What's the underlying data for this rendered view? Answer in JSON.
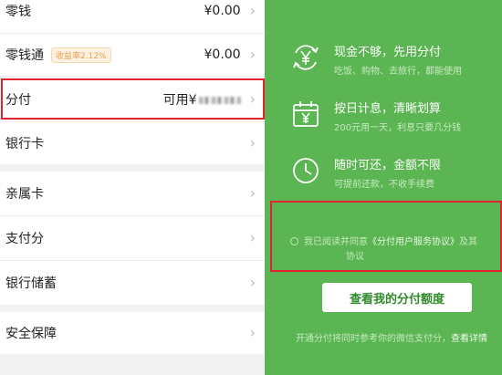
{
  "wallet": {
    "rows": [
      {
        "label": "零钱",
        "value": "¥0.00"
      },
      {
        "label": "零钱通",
        "badge": "收益率2.12%",
        "value": "¥0.00"
      },
      {
        "label": "分付",
        "value": "可用¥"
      },
      {
        "label": "银行卡"
      },
      {
        "label": "亲属卡"
      },
      {
        "label": "支付分"
      },
      {
        "label": "银行储蓄"
      },
      {
        "label": "安全保障"
      }
    ],
    "chevron": "›"
  },
  "promo": {
    "features": [
      {
        "icon": "yen-cycle-icon",
        "title": "现金不够，先用分付",
        "subtitle": "吃饭、购物、去旅行，都能使用"
      },
      {
        "icon": "calendar-yen-icon",
        "title": "按日计息，清晰划算",
        "subtitle": "200元用一天，利息只要几分钱"
      },
      {
        "icon": "clock-icon",
        "title": "随时可还，金额不限",
        "subtitle": "可提前还款，不收手续费"
      }
    ],
    "agreement": {
      "prefix": "我已阅读并同意",
      "link": "《分付用户服务协议》",
      "suffix": "及其",
      "line2": "协议"
    },
    "cta_label": "查看我的分付额度",
    "footer": {
      "text": "开通分付将同时参考你的微信支付分，",
      "link": "查看详情"
    }
  },
  "colors": {
    "green_bg": "#5bb552",
    "highlight": "#e0232f",
    "cta_text": "#2e8a2a"
  }
}
